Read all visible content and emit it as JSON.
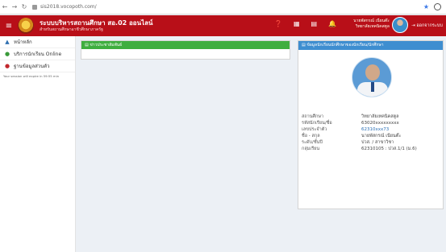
{
  "browser": {
    "url": "sis2018.vocopoth.com/"
  },
  "header": {
    "title": "ระบบบริหารสถานศึกษา สอ.02 ออนไลน์",
    "subtitle": "สำหรับสถานศึกษาอาชีวศึกษาภาครัฐ",
    "user_name": "นายพัสกรณ์ เนียนต๊ะ",
    "user_role": "วิทยาลัยเทคนิคสตูล",
    "logout_label": "ออกจากระบบ"
  },
  "sidebar": {
    "items": [
      {
        "label": "หน้าหลัก",
        "icon": "dashboard-icon",
        "color": "#2f6fb0"
      },
      {
        "label": "บริการนักเรียน Online",
        "icon": "student-icon",
        "color": "#3a9a3a"
      },
      {
        "label": "ฐานข้อมูลส่วนตัว",
        "icon": "profile-icon",
        "color": "#c1272d"
      }
    ],
    "note": "Your session will expire in 59:55 min"
  },
  "main": {
    "news_title": "ข่าวประชาสัมพันธ์",
    "profile_title": "ข้อมูลนักเรียนนักศึกษาของนักเรียน/นักศึกษา",
    "fields": [
      {
        "key": "สถานศึกษา",
        "value": "วิทยาลัยเทคนิคสตูล"
      },
      {
        "key": "รหัสนักเรียน/ชื่อ",
        "value": "63020xxxxxxxxx"
      },
      {
        "key": "เลขประจำตัว",
        "value": "62310xxx73",
        "link": true
      },
      {
        "key": "ชื่อ - สกุล",
        "value": "นายพัสกรณ์ เนียนต๊ะ"
      },
      {
        "key": "ระดับ/ชั้นปี",
        "value": "ปวส. / สาขาวิชา"
      },
      {
        "key": "กลุ่มเรียน",
        "value": "62310105 : ปวส.1/1 (ม.6)"
      }
    ]
  }
}
